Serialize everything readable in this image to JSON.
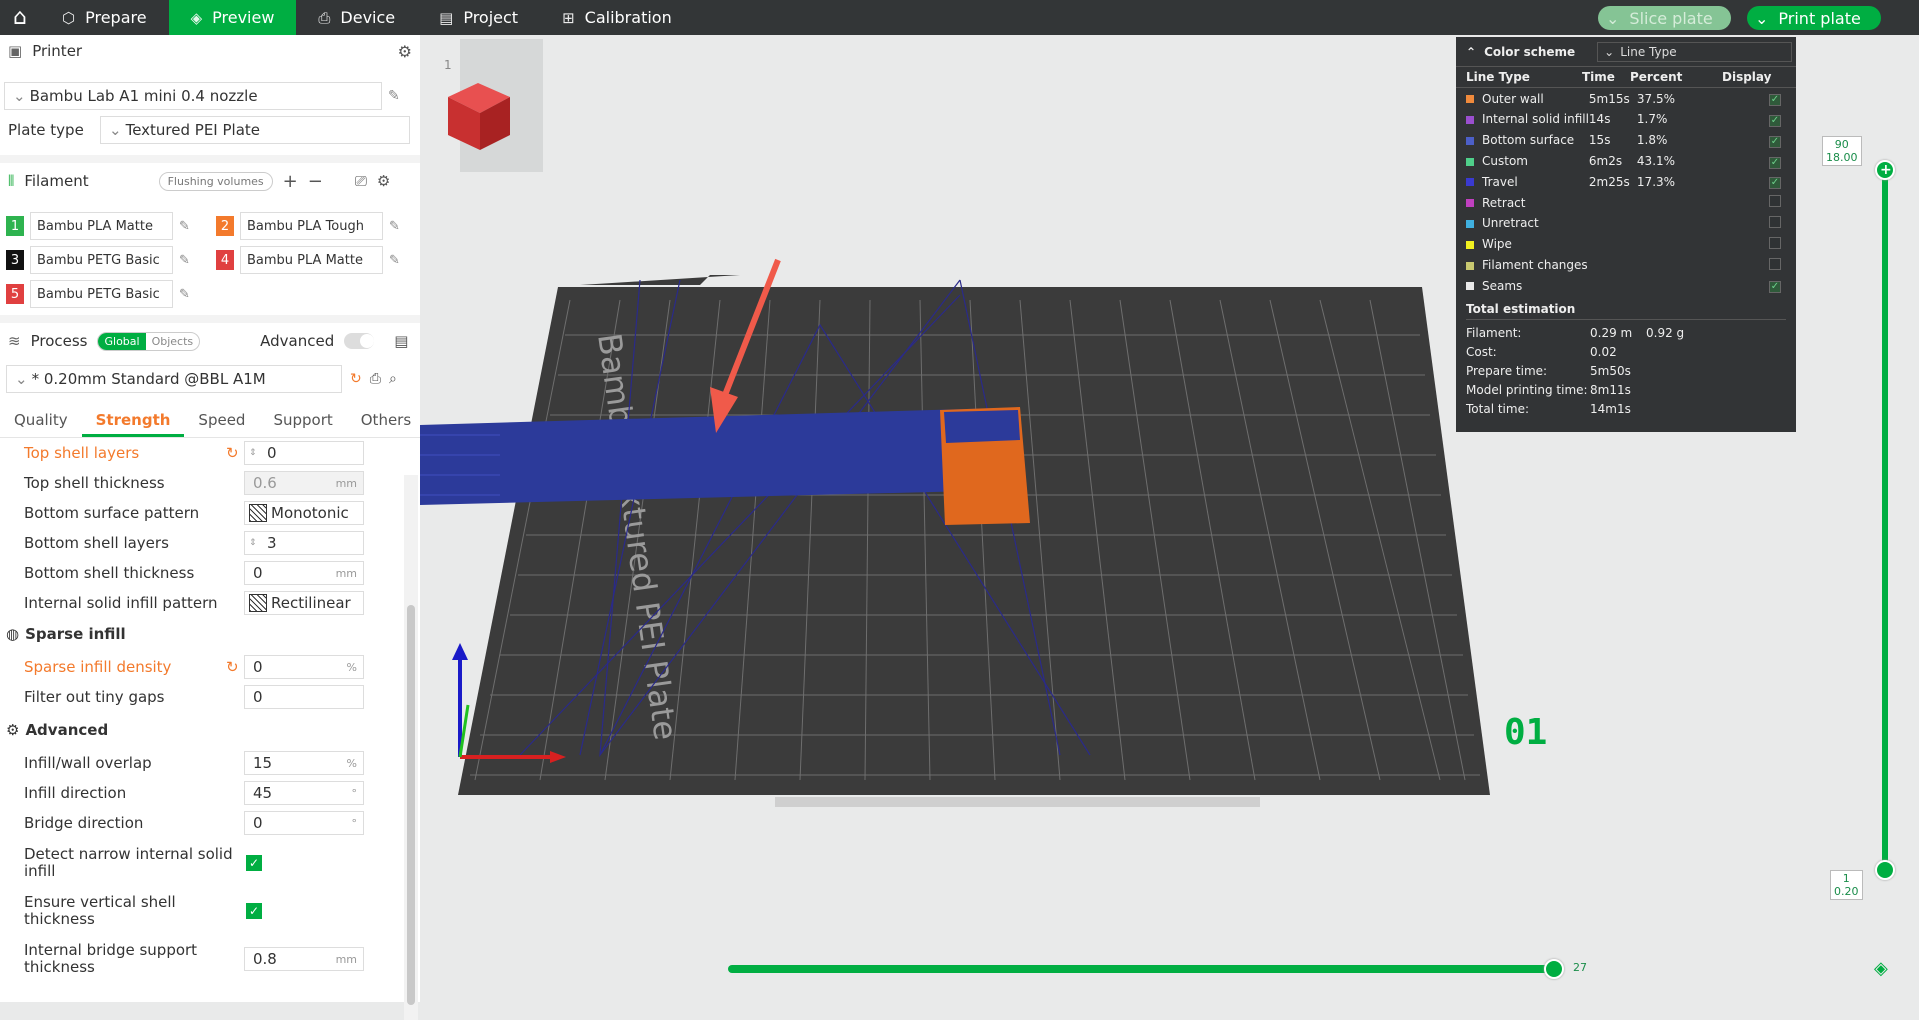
{
  "topbar": {
    "tabs": [
      {
        "label": "Prepare",
        "icon": "cube-icon"
      },
      {
        "label": "Preview",
        "icon": "layers-icon"
      },
      {
        "label": "Device",
        "icon": "device-icon"
      },
      {
        "label": "Project",
        "icon": "project-icon"
      },
      {
        "label": "Calibration",
        "icon": "calibration-icon"
      }
    ],
    "active": "Preview",
    "slice_label": "Slice plate",
    "print_label": "Print plate"
  },
  "printer": {
    "title": "Printer",
    "name": "Bambu Lab A1 mini 0.4 nozzle",
    "plate_type_label": "Plate type",
    "plate_type": "Textured PEI Plate"
  },
  "filament": {
    "title": "Filament",
    "flushing": "Flushing volumes",
    "items": [
      {
        "num": "1",
        "name": "Bambu PLA Matte",
        "color": "#2eb34f"
      },
      {
        "num": "2",
        "name": "Bambu PLA Tough",
        "color": "#f37a2c"
      },
      {
        "num": "3",
        "name": "Bambu PETG Basic",
        "color": "#111111"
      },
      {
        "num": "4",
        "name": "Bambu PLA Matte",
        "color": "#e04040"
      },
      {
        "num": "5",
        "name": "Bambu PETG Basic",
        "color": "#e04040"
      }
    ]
  },
  "process": {
    "title": "Process",
    "global": "Global",
    "objects": "Objects",
    "advanced": "Advanced",
    "preset": "* 0.20mm Standard @BBL A1M",
    "tabs": [
      "Quality",
      "Strength",
      "Speed",
      "Support",
      "Others"
    ],
    "active_tab": "Strength"
  },
  "settings": {
    "top_shell_layers": {
      "label": "Top shell layers",
      "value": "0"
    },
    "top_shell_thickness": {
      "label": "Top shell thickness",
      "value": "0.6",
      "unit": "mm"
    },
    "bottom_surface_pattern": {
      "label": "Bottom surface pattern",
      "value": "Monotonic"
    },
    "bottom_shell_layers": {
      "label": "Bottom shell layers",
      "value": "3"
    },
    "bottom_shell_thickness": {
      "label": "Bottom shell thickness",
      "value": "0",
      "unit": "mm"
    },
    "internal_solid_infill_pattern": {
      "label": "Internal solid infill pattern",
      "value": "Rectilinear"
    },
    "sparse_infill_title": "Sparse infill",
    "sparse_infill_density": {
      "label": "Sparse infill density",
      "value": "0",
      "unit": "%"
    },
    "filter_tiny_gaps": {
      "label": "Filter out tiny gaps",
      "value": "0"
    },
    "advanced_title": "Advanced",
    "infill_wall_overlap": {
      "label": "Infill/wall overlap",
      "value": "15",
      "unit": "%"
    },
    "infill_direction": {
      "label": "Infill direction",
      "value": "45",
      "unit": "°"
    },
    "bridge_direction": {
      "label": "Bridge direction",
      "value": "0",
      "unit": "°"
    },
    "detect_narrow": {
      "label1": "Detect narrow internal solid",
      "label2": "infill",
      "checked": true
    },
    "ensure_vertical": {
      "label1": "Ensure vertical shell",
      "label2": "thickness",
      "checked": true
    },
    "internal_bridge": {
      "label1": "Internal bridge support",
      "label2": "thickness",
      "value": "0.8",
      "unit": "mm"
    }
  },
  "legend": {
    "title": "Color scheme",
    "scheme": "Line Type",
    "columns": [
      "Line Type",
      "Time",
      "Percent",
      "Display"
    ],
    "rows": [
      {
        "name": "Outer wall",
        "color": "#f08a3c",
        "time": "5m15s",
        "percent": "37.5%",
        "display": true
      },
      {
        "name": "Internal solid infill",
        "color": "#9b4fcf",
        "time": "14s",
        "percent": "1.7%",
        "display": true
      },
      {
        "name": "Bottom surface",
        "color": "#4c5fc8",
        "time": "15s",
        "percent": "1.8%",
        "display": true
      },
      {
        "name": "Custom",
        "color": "#4fcf8a",
        "time": "6m2s",
        "percent": "43.1%",
        "display": true
      },
      {
        "name": "Travel",
        "color": "#3a3ad0",
        "time": "2m25s",
        "percent": "17.3%",
        "display": true
      },
      {
        "name": "Retract",
        "color": "#c040c0",
        "time": "",
        "percent": "",
        "display": false
      },
      {
        "name": "Unretract",
        "color": "#40b0e0",
        "time": "",
        "percent": "",
        "display": false
      },
      {
        "name": "Wipe",
        "color": "#f0f020",
        "time": "",
        "percent": "",
        "display": false
      },
      {
        "name": "Filament changes",
        "color": "#c8c870",
        "time": "",
        "percent": "",
        "display": false
      },
      {
        "name": "Seams",
        "color": "#e8e8e8",
        "time": "",
        "percent": "",
        "display": true
      }
    ],
    "total_title": "Total estimation",
    "filament_label": "Filament:",
    "filament_m": "0.29 m",
    "filament_g": "0.92 g",
    "cost_label": "Cost:",
    "cost": "0.02",
    "prepare_label": "Prepare time:",
    "prepare": "5m50s",
    "model_label": "Model printing time:",
    "model": "8m11s",
    "total_label": "Total time:",
    "total": "14m1s"
  },
  "layer_slider": {
    "top_layer": "90",
    "top_height": "18.00",
    "bottom_layer": "1",
    "bottom_height": "0.20"
  },
  "move_slider": {
    "value": "27"
  },
  "plate": {
    "number": "01",
    "bed_text": "Bambu Textured PEI Plate"
  },
  "thumb": {
    "index": "1"
  }
}
